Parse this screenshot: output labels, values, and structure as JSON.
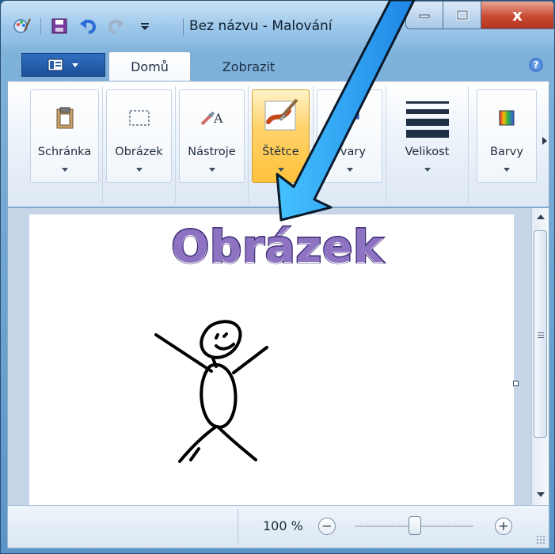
{
  "window": {
    "title": "Bez názvu - Malování",
    "buttons": {
      "close": "x"
    }
  },
  "ribbon": {
    "tabs": [
      {
        "label": "Domů",
        "active": true
      },
      {
        "label": "Zobrazit",
        "active": false
      }
    ],
    "groups": [
      {
        "label": "Schránka",
        "icon": "clipboard-icon"
      },
      {
        "label": "Obrázek",
        "icon": "select-rectangle-icon"
      },
      {
        "label": "Nástroje",
        "icon": "tools-icon"
      },
      {
        "label": "Štětce",
        "icon": "brush-icon",
        "active": true
      },
      {
        "label": "Tvary",
        "icon": "shapes-icon"
      },
      {
        "label": "Velikost",
        "icon": "line-size-icon"
      },
      {
        "label": "Barvy",
        "icon": "colors-icon"
      }
    ]
  },
  "canvas": {
    "heading": "Obrázek"
  },
  "statusbar": {
    "zoom_text": "100 %",
    "zoom_minus": "−",
    "zoom_plus": "+"
  },
  "colors": {
    "accent": "#1c7fd8",
    "arrow_fill": "#1e9bea",
    "heading_fill": "#8f73c3",
    "heading_outline": "#3e2f78"
  }
}
